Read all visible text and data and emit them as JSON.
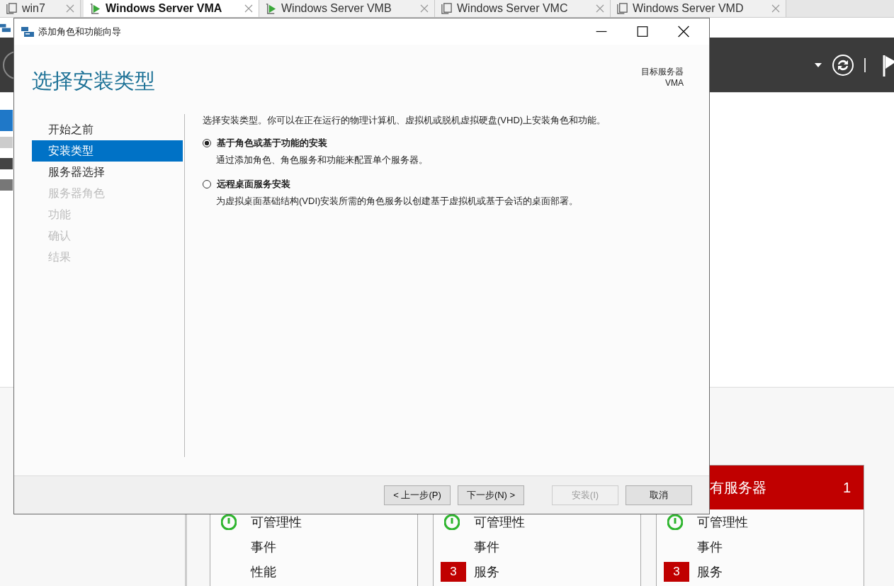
{
  "vm_tabs": [
    {
      "label": "win7",
      "selected": false,
      "running": false
    },
    {
      "label": "Windows Server VMA",
      "selected": true,
      "running": true
    },
    {
      "label": "Windows Server VMB",
      "selected": false,
      "running": true
    },
    {
      "label": "Windows Server VMC",
      "selected": false,
      "running": false
    },
    {
      "label": "Windows Server VMD",
      "selected": false,
      "running": false
    }
  ],
  "server_manager": {
    "cards": [
      {
        "rows": [
          {
            "kind": "ok",
            "label": "可管理性"
          },
          {
            "kind": "plain",
            "label": "事件"
          },
          {
            "kind": "plain",
            "label": "性能"
          }
        ]
      },
      {
        "rows": [
          {
            "kind": "ok",
            "label": "可管理性"
          },
          {
            "kind": "plain",
            "label": "事件"
          },
          {
            "kind": "alert",
            "badge": "3",
            "label": "服务"
          }
        ]
      },
      {
        "header": {
          "title": "有服务器",
          "count": "1"
        },
        "rows": [
          {
            "kind": "ok",
            "label": "可管理性"
          },
          {
            "kind": "plain",
            "label": "事件"
          },
          {
            "kind": "alert",
            "badge": "3",
            "label": "服务"
          }
        ]
      }
    ]
  },
  "dialog": {
    "title": "添加角色和功能向导",
    "heading": "选择安装类型",
    "target_label": "目标服务器",
    "target_server": "VMA",
    "steps": [
      {
        "label": "开始之前",
        "selected": false,
        "disabled": false
      },
      {
        "label": "安装类型",
        "selected": true,
        "disabled": false
      },
      {
        "label": "服务器选择",
        "selected": false,
        "disabled": false
      },
      {
        "label": "服务器角色",
        "selected": false,
        "disabled": true
      },
      {
        "label": "功能",
        "selected": false,
        "disabled": true
      },
      {
        "label": "确认",
        "selected": false,
        "disabled": true
      },
      {
        "label": "结果",
        "selected": false,
        "disabled": true
      }
    ],
    "intro": "选择安装类型。你可以在正在运行的物理计算机、虚拟机或脱机虚拟硬盘(VHD)上安装角色和功能。",
    "options": [
      {
        "title": "基于角色或基于功能的安装",
        "description": "通过添加角色、角色服务和功能来配置单个服务器。",
        "selected": true
      },
      {
        "title": "远程桌面服务安装",
        "description": "为虚拟桌面基础结构(VDI)安装所需的角色服务以创建基于虚拟机或基于会话的桌面部署。",
        "selected": false
      }
    ],
    "buttons": [
      {
        "label": "< 上一步(P)",
        "disabled": false
      },
      {
        "label": "下一步(N) >",
        "disabled": false
      },
      {
        "label": "安装(I)",
        "disabled": true
      },
      {
        "label": "取消",
        "disabled": false
      }
    ]
  }
}
